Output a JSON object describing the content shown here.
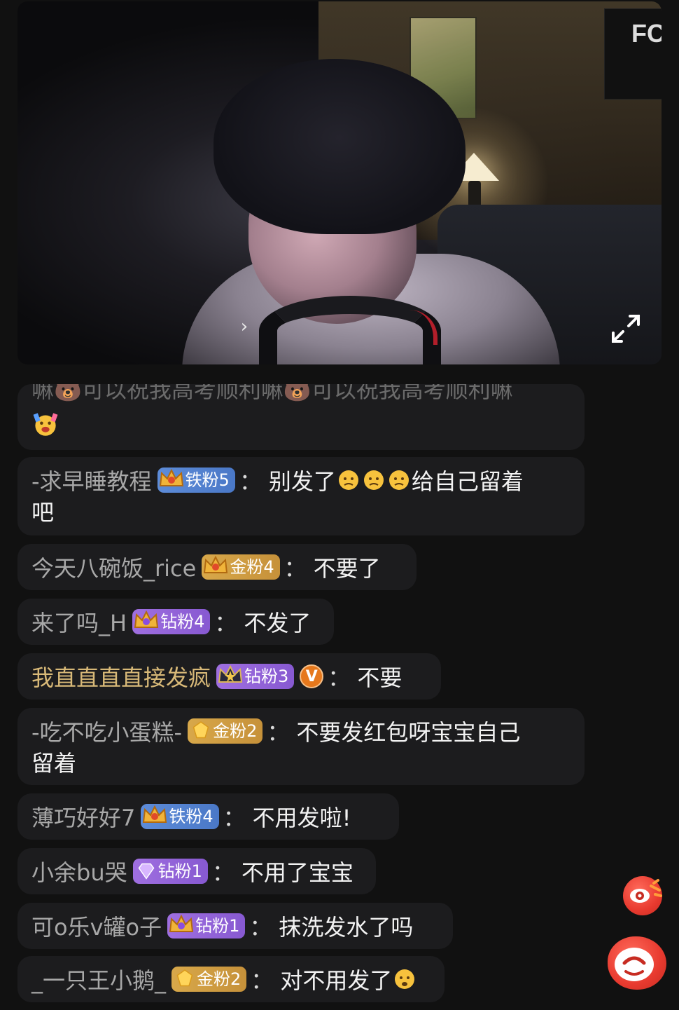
{
  "video": {
    "poster_text": "FC"
  },
  "chat": {
    "first_message": {
      "faded_text": "嘛🐻可以祝我高考顺利嘛🐻可以祝我高考顺利嘛",
      "emoji": "party-face"
    },
    "messages": [
      {
        "user": "-求早睡教程",
        "badge_type": "铁粉",
        "badge_label": "铁粉5",
        "text_line1": "别发了",
        "emojis": [
          "sad-face",
          "sad-face",
          "sad-face"
        ],
        "text_after": "给自己留着",
        "text_line2": "吧"
      },
      {
        "user": "今天八碗饭_rice",
        "badge_type": "金粉",
        "badge_label": "金粉4",
        "text": "不要了"
      },
      {
        "user": "来了吗_H",
        "badge_type": "钻粉",
        "badge_label": "钻粉4",
        "text": "不发了"
      },
      {
        "user": "我直直直直接发疯",
        "badge_type": "钻粉",
        "badge_label": "钻粉3",
        "text": "不要",
        "vip": "V"
      },
      {
        "user": "-吃不吃小蛋糕-",
        "badge_type": "金粉",
        "badge_label": "金粉2",
        "text_line1": "不要发红包呀宝宝自己",
        "text_line2": "留着"
      },
      {
        "user": "薄巧好好7",
        "badge_type": "铁粉",
        "badge_label": "铁粉4",
        "text": "不用发啦!"
      },
      {
        "user": "小余bu哭",
        "badge_type": "钻粉",
        "badge_label": "钻粉1",
        "text": "不用了宝宝"
      },
      {
        "user": "可o乐v罐o子",
        "badge_type": "钻粉",
        "badge_label": "钻粉1",
        "text": "抹洗发水了吗"
      },
      {
        "user": "_一只王小鹅_",
        "badge_type": "金粉",
        "badge_label": "金粉2",
        "text": "对不用发了"
      }
    ],
    "colon": "："
  },
  "floating": {
    "top_icon": "watch-eye-icon",
    "bottom_icon": "weibo-smile-icon"
  },
  "colors": {
    "background": "#111111",
    "bubble": "#1c1c1e",
    "username": "#a8a8a8",
    "username_highlight": "#d8b978",
    "badge_tie": "#5d8cd9",
    "badge_jin": "#d8a84a",
    "badge_zuan": "#9f6fe0",
    "accent_red": "#e83a2f"
  }
}
